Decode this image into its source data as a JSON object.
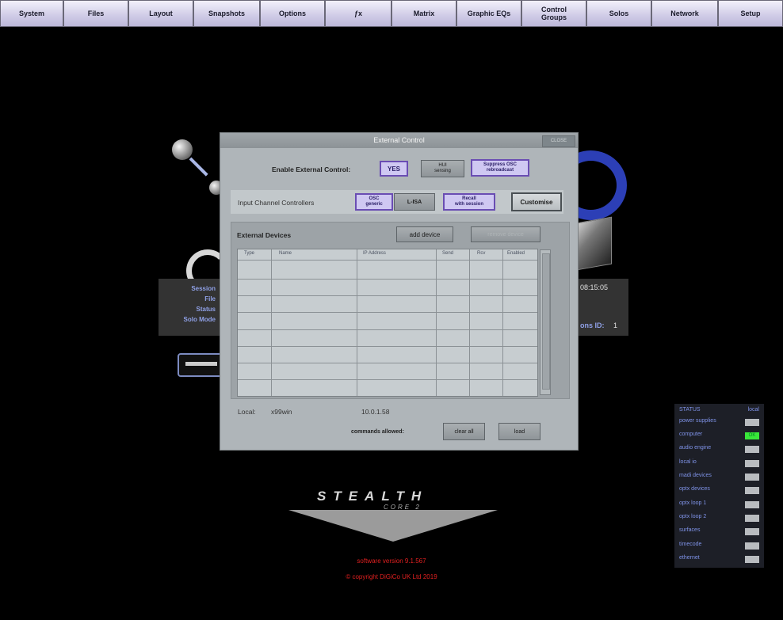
{
  "menu": [
    {
      "label": "System"
    },
    {
      "label": "Files"
    },
    {
      "label": "Layout"
    },
    {
      "label": "Snapshots"
    },
    {
      "label": "Options"
    },
    {
      "label": "ƒx"
    },
    {
      "label": "Matrix"
    },
    {
      "label": "Graphic EQs"
    },
    {
      "label": "Control\nGroups"
    },
    {
      "label": "Solos"
    },
    {
      "label": "Network"
    },
    {
      "label": "Setup"
    }
  ],
  "session_panel": {
    "session_label": "Session",
    "file_label": "File",
    "status_label": "Status",
    "solo_mode_label": "Solo Mode",
    "time_value": "08:15:05",
    "id_label": "ons ID:",
    "id_value": "1"
  },
  "dialog": {
    "title": "External Control",
    "close_label": "CLOSE",
    "enable_label": "Enable External Control:",
    "enable_yes": "YES",
    "hui_label": "HUI\nsensing",
    "suppress_label": "Suppress OSC\nrebroadcast",
    "input_label": "Input Channel Controllers",
    "osc_generic": "OSC\ngeneric",
    "lisa": "L-ISA",
    "recall_session": "Recall\nwith session",
    "customise": "Customise",
    "external_devices": "External Devices",
    "add_device": "add device",
    "remove_device": "remove device",
    "columns": [
      "Type",
      "Name",
      "IP Address",
      "Send",
      "Rcv",
      "Enabled"
    ],
    "local_label": "Local:",
    "local_host": "x99win",
    "local_ip": "10.0.1.58",
    "commands_label": "commands allowed:",
    "clear_all": "clear all",
    "load": "load"
  },
  "status": {
    "header": "STATUS",
    "header_right": "local",
    "items": [
      {
        "label": "power supplies",
        "state": ""
      },
      {
        "label": "computer",
        "state": "OK"
      },
      {
        "label": "audio engine",
        "state": ""
      },
      {
        "label": "local io",
        "state": ""
      },
      {
        "label": "madi devices",
        "state": ""
      },
      {
        "label": "optx devices",
        "state": ""
      },
      {
        "label": "optx loop 1",
        "state": ""
      },
      {
        "label": "optx loop 2",
        "state": ""
      },
      {
        "label": "surfaces",
        "state": ""
      },
      {
        "label": "timecode",
        "state": ""
      },
      {
        "label": "ethernet",
        "state": ""
      }
    ]
  },
  "branding": {
    "product": "STEALTH",
    "sub": "CORE 2",
    "version": "software version 9.1.567",
    "copyright": "© copyright DiGiCo UK Ltd 2019"
  },
  "colors": {
    "menu_bg": "#cfcbe6",
    "dialog_bg": "#afb5b9",
    "accent_purple": "#6a4db3",
    "status_ok": "#39e63a",
    "footer_red": "#e02020"
  }
}
